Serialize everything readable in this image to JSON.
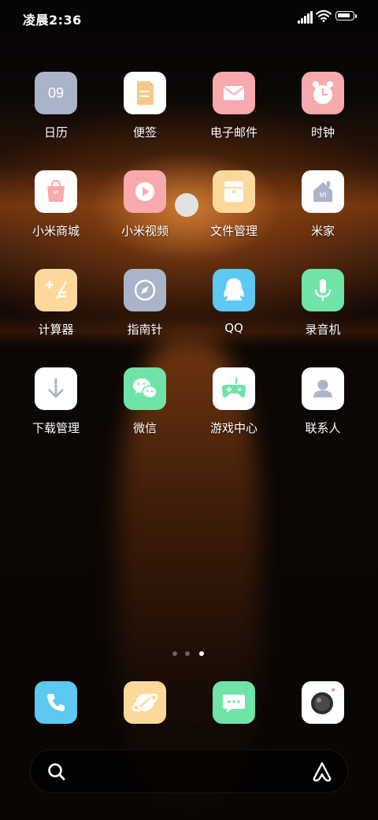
{
  "status_bar": {
    "time": "凌晨2:36",
    "signal_icon": "signal-icon",
    "wifi_icon": "wifi-icon",
    "battery_icon": "battery-icon",
    "battery_level": 0.9
  },
  "home": {
    "apps": [
      {
        "label": "日历",
        "icon": "calendar-icon",
        "icon_text": "09",
        "bg": "#aab4c8"
      },
      {
        "label": "便签",
        "icon": "notes-icon",
        "bg": "#ffffff"
      },
      {
        "label": "电子邮件",
        "icon": "mail-icon",
        "bg": "#f7a9ae"
      },
      {
        "label": "时钟",
        "icon": "clock-icon",
        "bg": "#f7a9ae"
      },
      {
        "label": "小米商城",
        "icon": "mi-store-icon",
        "icon_text": "MI",
        "bg": "#ffffff"
      },
      {
        "label": "小米视频",
        "icon": "video-icon",
        "bg": "#f7a9ae"
      },
      {
        "label": "文件管理",
        "icon": "folder-icon",
        "bg": "#fcd89a"
      },
      {
        "label": "米家",
        "icon": "mijia-icon",
        "icon_text": "MI",
        "bg": "#ffffff"
      },
      {
        "label": "计算器",
        "icon": "calculator-icon",
        "bg": "#fcd89a"
      },
      {
        "label": "指南针",
        "icon": "compass-icon",
        "bg": "#aab4c8"
      },
      {
        "label": "QQ",
        "icon": "qq-icon",
        "bg": "#5dc8f2"
      },
      {
        "label": "录音机",
        "icon": "microphone-icon",
        "bg": "#6fe3a8"
      },
      {
        "label": "下载管理",
        "icon": "download-icon",
        "bg": "#ffffff"
      },
      {
        "label": "微信",
        "icon": "wechat-icon",
        "bg": "#6fe3a8"
      },
      {
        "label": "游戏中心",
        "icon": "gamepad-icon",
        "bg": "#ffffff"
      },
      {
        "label": "联系人",
        "icon": "contacts-icon",
        "bg": "#ffffff"
      }
    ],
    "page_indicator": {
      "pages": 3,
      "current": 3
    }
  },
  "dock": [
    {
      "icon": "phone-icon",
      "bg": "#5dc8f2"
    },
    {
      "icon": "browser-icon",
      "bg": "#fcd89a"
    },
    {
      "icon": "messages-icon",
      "bg": "#6fe3a8"
    },
    {
      "icon": "camera-icon",
      "bg": "#ffffff"
    }
  ],
  "search_bar": {
    "search_icon": "search-icon",
    "assistant_icon": "assistant-icon"
  }
}
